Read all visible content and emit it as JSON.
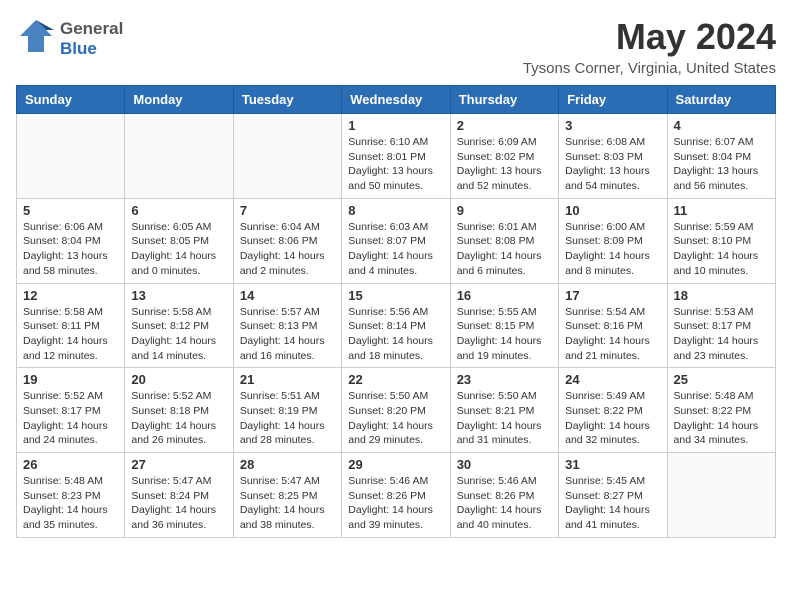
{
  "header": {
    "logo_general": "General",
    "logo_blue": "Blue",
    "month_title": "May 2024",
    "location": "Tysons Corner, Virginia, United States"
  },
  "weekdays": [
    "Sunday",
    "Monday",
    "Tuesday",
    "Wednesday",
    "Thursday",
    "Friday",
    "Saturday"
  ],
  "weeks": [
    [
      {
        "day": "",
        "info": ""
      },
      {
        "day": "",
        "info": ""
      },
      {
        "day": "",
        "info": ""
      },
      {
        "day": "1",
        "info": "Sunrise: 6:10 AM\nSunset: 8:01 PM\nDaylight: 13 hours\nand 50 minutes."
      },
      {
        "day": "2",
        "info": "Sunrise: 6:09 AM\nSunset: 8:02 PM\nDaylight: 13 hours\nand 52 minutes."
      },
      {
        "day": "3",
        "info": "Sunrise: 6:08 AM\nSunset: 8:03 PM\nDaylight: 13 hours\nand 54 minutes."
      },
      {
        "day": "4",
        "info": "Sunrise: 6:07 AM\nSunset: 8:04 PM\nDaylight: 13 hours\nand 56 minutes."
      }
    ],
    [
      {
        "day": "5",
        "info": "Sunrise: 6:06 AM\nSunset: 8:04 PM\nDaylight: 13 hours\nand 58 minutes."
      },
      {
        "day": "6",
        "info": "Sunrise: 6:05 AM\nSunset: 8:05 PM\nDaylight: 14 hours\nand 0 minutes."
      },
      {
        "day": "7",
        "info": "Sunrise: 6:04 AM\nSunset: 8:06 PM\nDaylight: 14 hours\nand 2 minutes."
      },
      {
        "day": "8",
        "info": "Sunrise: 6:03 AM\nSunset: 8:07 PM\nDaylight: 14 hours\nand 4 minutes."
      },
      {
        "day": "9",
        "info": "Sunrise: 6:01 AM\nSunset: 8:08 PM\nDaylight: 14 hours\nand 6 minutes."
      },
      {
        "day": "10",
        "info": "Sunrise: 6:00 AM\nSunset: 8:09 PM\nDaylight: 14 hours\nand 8 minutes."
      },
      {
        "day": "11",
        "info": "Sunrise: 5:59 AM\nSunset: 8:10 PM\nDaylight: 14 hours\nand 10 minutes."
      }
    ],
    [
      {
        "day": "12",
        "info": "Sunrise: 5:58 AM\nSunset: 8:11 PM\nDaylight: 14 hours\nand 12 minutes."
      },
      {
        "day": "13",
        "info": "Sunrise: 5:58 AM\nSunset: 8:12 PM\nDaylight: 14 hours\nand 14 minutes."
      },
      {
        "day": "14",
        "info": "Sunrise: 5:57 AM\nSunset: 8:13 PM\nDaylight: 14 hours\nand 16 minutes."
      },
      {
        "day": "15",
        "info": "Sunrise: 5:56 AM\nSunset: 8:14 PM\nDaylight: 14 hours\nand 18 minutes."
      },
      {
        "day": "16",
        "info": "Sunrise: 5:55 AM\nSunset: 8:15 PM\nDaylight: 14 hours\nand 19 minutes."
      },
      {
        "day": "17",
        "info": "Sunrise: 5:54 AM\nSunset: 8:16 PM\nDaylight: 14 hours\nand 21 minutes."
      },
      {
        "day": "18",
        "info": "Sunrise: 5:53 AM\nSunset: 8:17 PM\nDaylight: 14 hours\nand 23 minutes."
      }
    ],
    [
      {
        "day": "19",
        "info": "Sunrise: 5:52 AM\nSunset: 8:17 PM\nDaylight: 14 hours\nand 24 minutes."
      },
      {
        "day": "20",
        "info": "Sunrise: 5:52 AM\nSunset: 8:18 PM\nDaylight: 14 hours\nand 26 minutes."
      },
      {
        "day": "21",
        "info": "Sunrise: 5:51 AM\nSunset: 8:19 PM\nDaylight: 14 hours\nand 28 minutes."
      },
      {
        "day": "22",
        "info": "Sunrise: 5:50 AM\nSunset: 8:20 PM\nDaylight: 14 hours\nand 29 minutes."
      },
      {
        "day": "23",
        "info": "Sunrise: 5:50 AM\nSunset: 8:21 PM\nDaylight: 14 hours\nand 31 minutes."
      },
      {
        "day": "24",
        "info": "Sunrise: 5:49 AM\nSunset: 8:22 PM\nDaylight: 14 hours\nand 32 minutes."
      },
      {
        "day": "25",
        "info": "Sunrise: 5:48 AM\nSunset: 8:22 PM\nDaylight: 14 hours\nand 34 minutes."
      }
    ],
    [
      {
        "day": "26",
        "info": "Sunrise: 5:48 AM\nSunset: 8:23 PM\nDaylight: 14 hours\nand 35 minutes."
      },
      {
        "day": "27",
        "info": "Sunrise: 5:47 AM\nSunset: 8:24 PM\nDaylight: 14 hours\nand 36 minutes."
      },
      {
        "day": "28",
        "info": "Sunrise: 5:47 AM\nSunset: 8:25 PM\nDaylight: 14 hours\nand 38 minutes."
      },
      {
        "day": "29",
        "info": "Sunrise: 5:46 AM\nSunset: 8:26 PM\nDaylight: 14 hours\nand 39 minutes."
      },
      {
        "day": "30",
        "info": "Sunrise: 5:46 AM\nSunset: 8:26 PM\nDaylight: 14 hours\nand 40 minutes."
      },
      {
        "day": "31",
        "info": "Sunrise: 5:45 AM\nSunset: 8:27 PM\nDaylight: 14 hours\nand 41 minutes."
      },
      {
        "day": "",
        "info": ""
      }
    ]
  ]
}
